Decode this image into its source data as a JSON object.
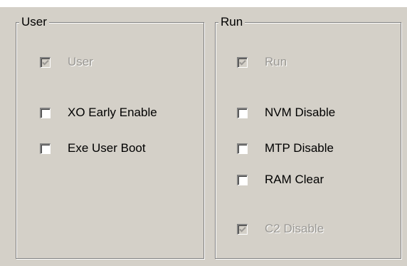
{
  "user_group": {
    "title": "User",
    "checkboxes": [
      {
        "label": "User",
        "checked": true,
        "enabled": false
      },
      {
        "label": "XO Early Enable",
        "checked": false,
        "enabled": true
      },
      {
        "label": "Exe User Boot",
        "checked": false,
        "enabled": true
      }
    ]
  },
  "run_group": {
    "title": "Run",
    "checkboxes": [
      {
        "label": "Run",
        "checked": true,
        "enabled": false
      },
      {
        "label": "NVM Disable",
        "checked": false,
        "enabled": true
      },
      {
        "label": "MTP Disable",
        "checked": false,
        "enabled": true
      },
      {
        "label": "RAM Clear",
        "checked": false,
        "enabled": true
      },
      {
        "label": "C2 Disable",
        "checked": true,
        "enabled": false
      }
    ]
  },
  "colors": {
    "window_bg": "#d4d0c8",
    "disabled_text": "#9a9894",
    "border_shadow": "#808080",
    "border_highlight": "#ffffff"
  },
  "icons": {
    "checkmark": "check-icon"
  }
}
